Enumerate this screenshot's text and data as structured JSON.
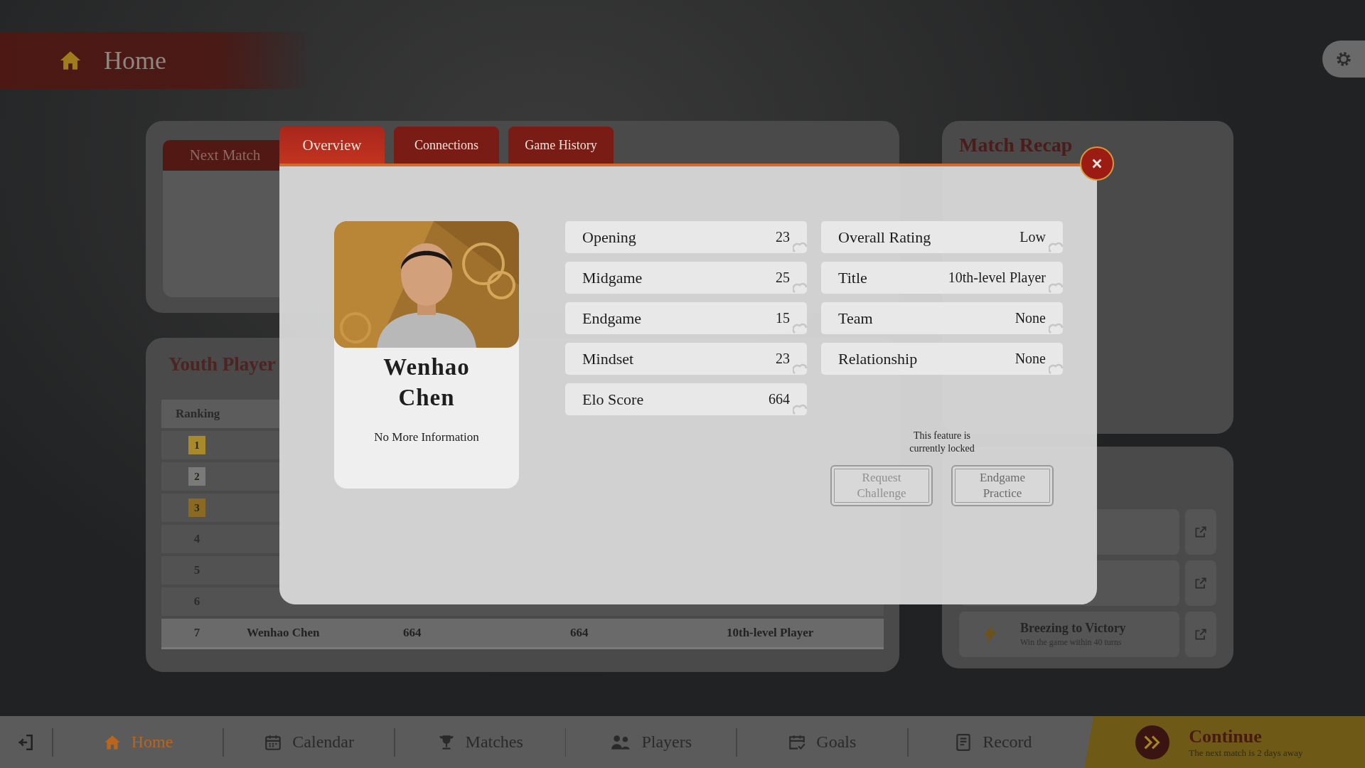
{
  "header": {
    "title": "Home"
  },
  "next_match": {
    "tab": "Next Match"
  },
  "ranking": {
    "title": "Youth Player",
    "columns": [
      "Ranking"
    ],
    "rows": [
      {
        "rank": "1",
        "kind": "medal",
        "color": "#a88a2a",
        "highlighted": false
      },
      {
        "rank": "2",
        "kind": "medal",
        "color": "#7a7a7a",
        "highlighted": false
      },
      {
        "rank": "3",
        "kind": "medal",
        "color": "#8a6a22",
        "highlighted": false
      },
      {
        "rank": "4",
        "kind": "number",
        "highlighted": false
      },
      {
        "rank": "5",
        "kind": "number",
        "highlighted": false
      },
      {
        "rank": "6",
        "kind": "number",
        "highlighted": false
      },
      {
        "rank": "7",
        "kind": "number",
        "highlighted": true,
        "cells": [
          "Wenhao Chen",
          "664",
          "664",
          "10th-level Player"
        ]
      }
    ]
  },
  "match_recap": {
    "title": "Match Recap"
  },
  "objectives": {
    "items": [
      {
        "title": "Breezing to Victory",
        "subtitle": "Win the game within 40 turns"
      }
    ]
  },
  "modal": {
    "tabs": [
      {
        "label": "Overview",
        "selected": true
      },
      {
        "label": "Connections",
        "selected": false
      },
      {
        "label": "Game History",
        "selected": false
      }
    ],
    "player": {
      "name": "Wenhao Chen",
      "info": "No More Information"
    },
    "stats": [
      {
        "label": "Opening",
        "value": "23"
      },
      {
        "label": "Midgame",
        "value": "25"
      },
      {
        "label": "Endgame",
        "value": "15"
      },
      {
        "label": "Mindset",
        "value": "23"
      },
      {
        "label": "Elo Score",
        "value": "664"
      }
    ],
    "attributes": [
      {
        "label": "Overall Rating",
        "value": "Low"
      },
      {
        "label": "Title",
        "value": "10th-level Player"
      },
      {
        "label": "Team",
        "value": "None"
      },
      {
        "label": "Relationship",
        "value": "None"
      }
    ],
    "locked_note": "This feature is currently locked",
    "buttons": [
      {
        "label": "Request Challenge",
        "disabled": true
      },
      {
        "label": "Endgame Practice",
        "disabled": false
      }
    ]
  },
  "nav": {
    "items": [
      {
        "kind": "home",
        "label": "Home",
        "selected": true
      },
      {
        "kind": "calendar",
        "label": "Calendar",
        "selected": false
      },
      {
        "kind": "trophy",
        "label": "Matches",
        "selected": false
      },
      {
        "kind": "players",
        "label": "Players",
        "selected": false
      },
      {
        "kind": "goals",
        "label": "Goals",
        "selected": false
      },
      {
        "kind": "record",
        "label": "Record",
        "selected": false
      }
    ],
    "continue": {
      "title": "Continue",
      "subtitle": "The next match is 2 days away"
    }
  }
}
